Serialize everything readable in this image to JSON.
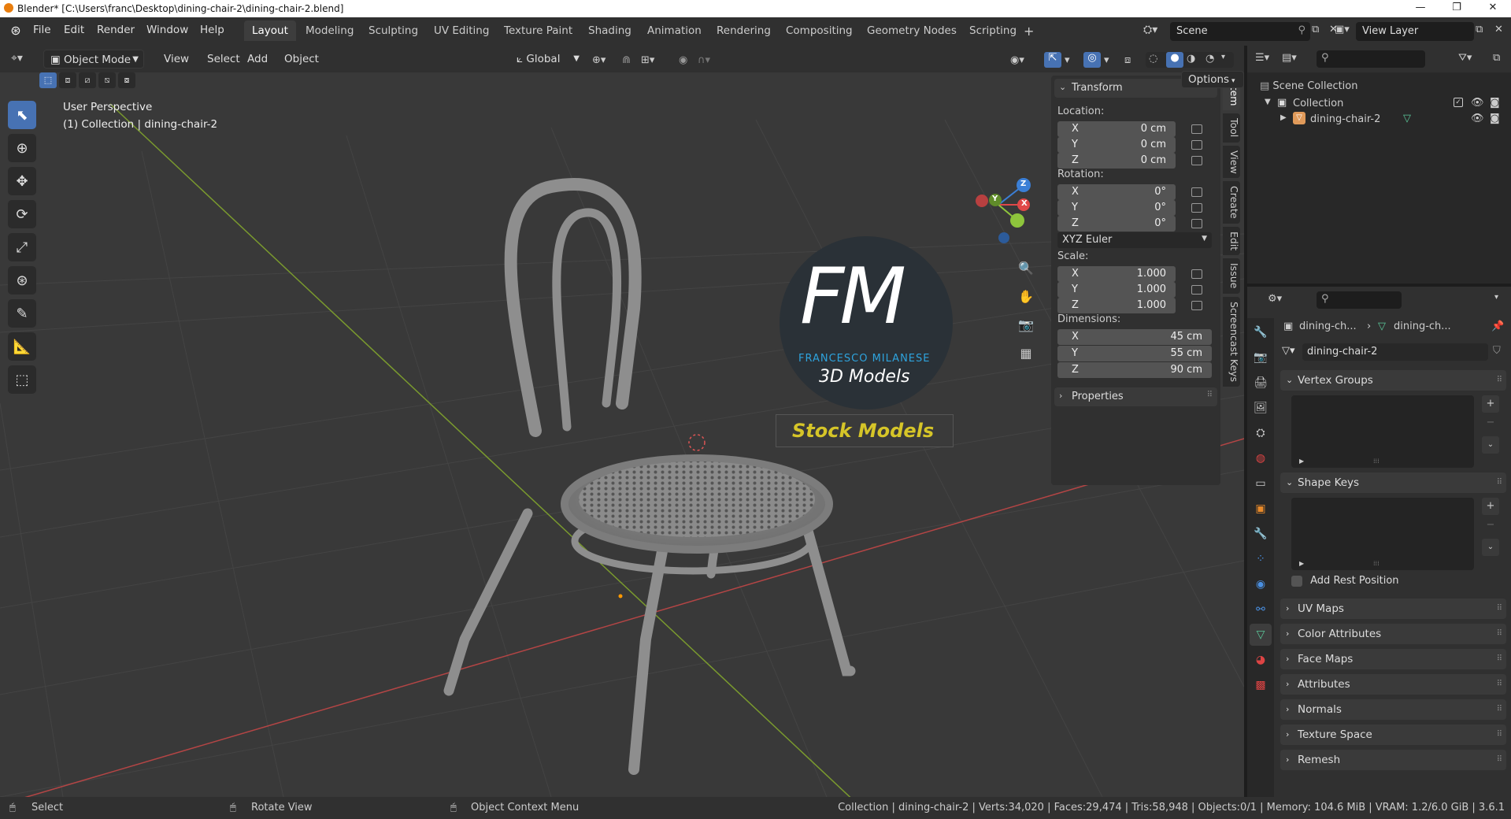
{
  "title_bar": {
    "title": "Blender* [C:\\Users\\franc\\Desktop\\dining-chair-2\\dining-chair-2.blend]",
    "controls": [
      "—",
      "❐",
      "✕"
    ]
  },
  "menu": [
    "File",
    "Edit",
    "Render",
    "Window",
    "Help"
  ],
  "workspaces": [
    {
      "label": "Layout",
      "active": true
    },
    {
      "label": "Modeling"
    },
    {
      "label": "Sculpting"
    },
    {
      "label": "UV Editing"
    },
    {
      "label": "Texture Paint"
    },
    {
      "label": "Shading"
    },
    {
      "label": "Animation"
    },
    {
      "label": "Rendering"
    },
    {
      "label": "Compositing"
    },
    {
      "label": "Geometry Nodes"
    },
    {
      "label": "Scripting"
    }
  ],
  "scene": {
    "label": "Scene"
  },
  "view_layer": {
    "label": "View Layer"
  },
  "viewport_header": {
    "mode": "Object Mode",
    "menus": [
      "View",
      "Select",
      "Add",
      "Object"
    ],
    "transform_orientation": "Global",
    "options": "Options"
  },
  "viewport": {
    "perspective": "User Perspective",
    "collection_info": "(1) Collection | dining-chair-2",
    "watermark": {
      "brand": "FM",
      "name": "FRANCESCO MILANESE",
      "sub": "3D Models",
      "badge": "Stock Models"
    },
    "gizmo_axes": [
      "X",
      "Y",
      "Z"
    ]
  },
  "transform_panel": {
    "title": "Transform",
    "location_label": "Location:",
    "location": [
      {
        "axis": "X",
        "value": "0 cm"
      },
      {
        "axis": "Y",
        "value": "0 cm"
      },
      {
        "axis": "Z",
        "value": "0 cm"
      }
    ],
    "rotation_label": "Rotation:",
    "rotation": [
      {
        "axis": "X",
        "value": "0°"
      },
      {
        "axis": "Y",
        "value": "0°"
      },
      {
        "axis": "Z",
        "value": "0°"
      }
    ],
    "rotation_mode": "XYZ Euler",
    "scale_label": "Scale:",
    "scale": [
      {
        "axis": "X",
        "value": "1.000"
      },
      {
        "axis": "Y",
        "value": "1.000"
      },
      {
        "axis": "Z",
        "value": "1.000"
      }
    ],
    "dimensions_label": "Dimensions:",
    "dimensions": [
      {
        "axis": "X",
        "value": "45 cm"
      },
      {
        "axis": "Y",
        "value": "55 cm"
      },
      {
        "axis": "Z",
        "value": "90 cm"
      }
    ],
    "properties": "Properties"
  },
  "sidebar_tabs": [
    "Item",
    "Tool",
    "View",
    "Create",
    "Edit",
    "Issue",
    "Screencast Keys"
  ],
  "outliner": {
    "scene_collection": "Scene Collection",
    "collection": "Collection",
    "object": "dining-chair-2"
  },
  "properties": {
    "breadcrumb_object": "dining-ch...",
    "breadcrumb_mesh": "dining-ch...",
    "mesh_name": "dining-chair-2",
    "panels": {
      "vertex_groups": "Vertex Groups",
      "shape_keys": "Shape Keys",
      "add_rest_position": "Add Rest Position",
      "uv_maps": "UV Maps",
      "color_attributes": "Color Attributes",
      "face_maps": "Face Maps",
      "attributes": "Attributes",
      "normals": "Normals",
      "texture_space": "Texture Space",
      "remesh": "Remesh"
    }
  },
  "status_bar": {
    "select": "Select",
    "rotate": "Rotate View",
    "context_menu": "Object Context Menu",
    "stats": "Collection | dining-chair-2 | Verts:34,020 | Faces:29,474 | Tris:58,948 | Objects:0/1 | Memory: 104.6 MiB | VRAM: 1.2/6.0 GiB | 3.6.1"
  },
  "colors": {
    "accent_blue": "#4772b3",
    "axis_x": "#e04848",
    "axis_y": "#8ec53c",
    "axis_z": "#3b7fd6",
    "brand_blue": "#2ea3dd",
    "badge_text": "#d6c528"
  }
}
